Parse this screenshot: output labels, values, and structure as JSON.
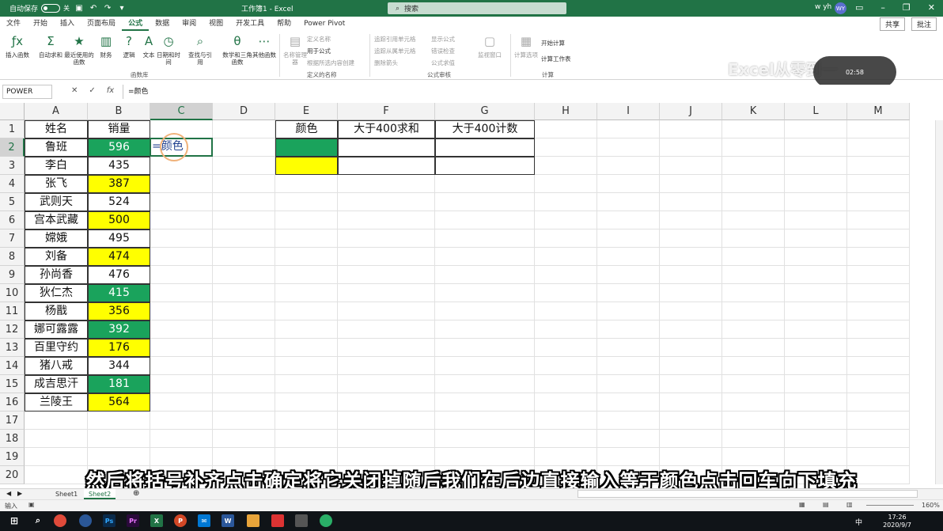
{
  "titlebar": {
    "autosave_label": "自动保存",
    "autosave_state": "关",
    "doc_title": "工作簿1 - Excel",
    "search_placeholder": "搜索",
    "user_name": "w yh",
    "user_initials": "WY"
  },
  "tabs": [
    "文件",
    "开始",
    "插入",
    "页面布局",
    "公式",
    "数据",
    "审阅",
    "视图",
    "开发工具",
    "帮助",
    "Power Pivot"
  ],
  "active_tab": "公式",
  "share_labels": {
    "share": "共享",
    "comments": "批注"
  },
  "ribbon": {
    "library_buttons": [
      {
        "label": "插入函数",
        "icon": "fx-icon"
      },
      {
        "label": "自动求和",
        "icon": "sum-icon"
      },
      {
        "label": "最近使用的函数",
        "icon": "star-icon"
      },
      {
        "label": "财务",
        "icon": "finance-icon"
      },
      {
        "label": "逻辑",
        "icon": "logic-icon"
      },
      {
        "label": "文本",
        "icon": "text-icon"
      },
      {
        "label": "日期和时间",
        "icon": "clock-icon"
      },
      {
        "label": "查找与引用",
        "icon": "lookup-icon"
      },
      {
        "label": "数学和三角函数",
        "icon": "math-icon"
      },
      {
        "label": "其他函数",
        "icon": "more-icon"
      }
    ],
    "group_library": "函数库",
    "name_manager": "名称管理器",
    "define_name": "定义名称",
    "use_in_formula": "用于公式",
    "create_from_selection": "根据所选内容创建",
    "group_names": "定义的名称",
    "trace_precedents": "追踪引用单元格",
    "trace_dependents": "追踪从属单元格",
    "remove_arrows": "删除箭头",
    "show_formulas": "显示公式",
    "error_checking": "错误检查",
    "evaluate_formula": "公式求值",
    "watch_window": "监视窗口",
    "group_auditing": "公式审核",
    "calc_options": "计算选项",
    "calc_now": "开始计算",
    "calc_sheet": "计算工作表",
    "group_calc": "计算",
    "watermark": "Excel从零到一",
    "video_time": "02:58"
  },
  "formula_bar": {
    "name_box": "POWER",
    "cancel": "✕",
    "enter": "✓",
    "fx": "fx",
    "formula": "=颜色"
  },
  "columns": [
    "A",
    "B",
    "C",
    "D",
    "E",
    "F",
    "G",
    "H",
    "I",
    "J",
    "K",
    "L",
    "M"
  ],
  "rows": [
    "1",
    "2",
    "3",
    "4",
    "5",
    "6",
    "7",
    "8",
    "9",
    "10",
    "11",
    "12",
    "13",
    "14",
    "15",
    "16",
    "17",
    "18",
    "19",
    "20"
  ],
  "table": {
    "header_name": "姓名",
    "header_sales": "销量",
    "data": [
      {
        "name": "鲁班",
        "sales": "596",
        "fill": "green"
      },
      {
        "name": "李白",
        "sales": "435",
        "fill": "none"
      },
      {
        "name": "张飞",
        "sales": "387",
        "fill": "yellow"
      },
      {
        "name": "武则天",
        "sales": "524",
        "fill": "none"
      },
      {
        "name": "宫本武藏",
        "sales": "500",
        "fill": "yellow"
      },
      {
        "name": "嫦娥",
        "sales": "495",
        "fill": "none"
      },
      {
        "name": "刘备",
        "sales": "474",
        "fill": "yellow"
      },
      {
        "name": "孙尚香",
        "sales": "476",
        "fill": "none"
      },
      {
        "name": "狄仁杰",
        "sales": "415",
        "fill": "green"
      },
      {
        "name": "杨戬",
        "sales": "356",
        "fill": "yellow"
      },
      {
        "name": "娜可露露",
        "sales": "392",
        "fill": "green"
      },
      {
        "name": "百里守约",
        "sales": "176",
        "fill": "yellow"
      },
      {
        "name": "猪八戒",
        "sales": "344",
        "fill": "none"
      },
      {
        "name": "成吉思汗",
        "sales": "181",
        "fill": "green"
      },
      {
        "name": "兰陵王",
        "sales": "564",
        "fill": "yellow"
      }
    ]
  },
  "active_cell_text": "=颜色",
  "summary": {
    "header_color": "颜色",
    "header_sum": "大于400求和",
    "header_count": "大于400计数"
  },
  "colors": {
    "green": "#1aa35c",
    "yellow": "#ffff00",
    "accent": "#217346"
  },
  "subtitle": "然后将括号补齐点击确定将它关闭掉随后我们在后边直接输入等于颜色点击回车向下填充",
  "sheets": [
    "Sheet1",
    "Sheet2"
  ],
  "active_sheet": "Sheet2",
  "status": {
    "mode": "输入",
    "zoom": "160%"
  },
  "clock": {
    "time": "17:26",
    "date": "2020/9/7"
  },
  "ime": "中"
}
